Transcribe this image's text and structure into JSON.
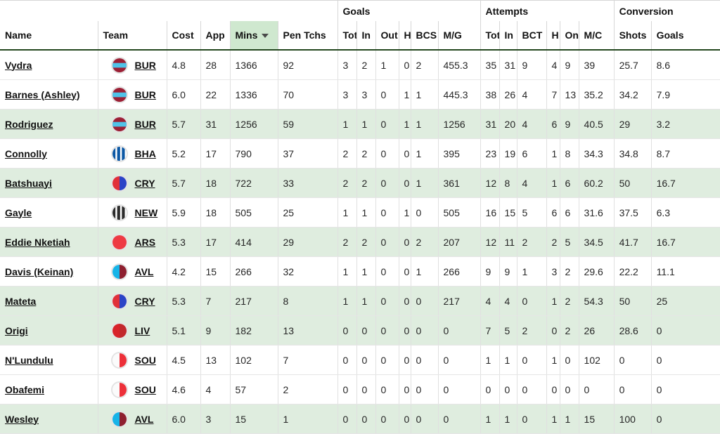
{
  "table": {
    "group_headers": [
      {
        "label": "",
        "span": 6
      },
      {
        "label": "Goals",
        "span": 6
      },
      {
        "label": "Attempts",
        "span": 6
      },
      {
        "label": "Conversion",
        "span": 2
      }
    ],
    "columns": [
      {
        "key": "name",
        "label": "Name",
        "sorted": false
      },
      {
        "key": "team",
        "label": "Team",
        "sorted": false
      },
      {
        "key": "cost",
        "label": "Cost",
        "sorted": false
      },
      {
        "key": "app",
        "label": "App",
        "sorted": false
      },
      {
        "key": "mins",
        "label": "Mins",
        "sorted": true,
        "sort_dir": "desc",
        "sort_icon": "caret-down-icon"
      },
      {
        "key": "pen",
        "label": "Pen Tchs",
        "sorted": false
      },
      {
        "key": "gtot",
        "label": "Tot",
        "sorted": false
      },
      {
        "key": "gin",
        "label": "In",
        "sorted": false
      },
      {
        "key": "gout",
        "label": "Out",
        "sorted": false
      },
      {
        "key": "gh",
        "label": "H",
        "sorted": false
      },
      {
        "key": "gbcs",
        "label": "BCS",
        "sorted": false
      },
      {
        "key": "gmg",
        "label": "M/G",
        "sorted": false
      },
      {
        "key": "atot",
        "label": "Tot",
        "sorted": false
      },
      {
        "key": "ain",
        "label": "In",
        "sorted": false
      },
      {
        "key": "abct",
        "label": "BCT",
        "sorted": false
      },
      {
        "key": "ah",
        "label": "H",
        "sorted": false
      },
      {
        "key": "aon",
        "label": "On",
        "sorted": false
      },
      {
        "key": "amc",
        "label": "M/C",
        "sorted": false
      },
      {
        "key": "cshots",
        "label": "Shots",
        "sorted": false
      },
      {
        "key": "cgoals",
        "label": "Goals",
        "sorted": false
      }
    ],
    "rows": [
      {
        "name": "Vydra",
        "team": "BUR",
        "badge": "bur-badge",
        "shaded": false,
        "cost": "4.8",
        "app": "28",
        "mins": "1366",
        "pen": "92",
        "gtot": "3",
        "gin": "2",
        "gout": "1",
        "gh": "0",
        "gbcs": "2",
        "gmg": "455.3",
        "atot": "35",
        "ain": "31",
        "abct": "9",
        "ah": "4",
        "aon": "9",
        "amc": "39",
        "cshots": "25.7",
        "cgoals": "8.6"
      },
      {
        "name": "Barnes (Ashley)",
        "team": "BUR",
        "badge": "bur-badge",
        "shaded": false,
        "cost": "6.0",
        "app": "22",
        "mins": "1336",
        "pen": "70",
        "gtot": "3",
        "gin": "3",
        "gout": "0",
        "gh": "1",
        "gbcs": "1",
        "gmg": "445.3",
        "atot": "38",
        "ain": "26",
        "abct": "4",
        "ah": "7",
        "aon": "13",
        "amc": "35.2",
        "cshots": "34.2",
        "cgoals": "7.9"
      },
      {
        "name": "Rodriguez",
        "team": "BUR",
        "badge": "bur-badge",
        "shaded": true,
        "cost": "5.7",
        "app": "31",
        "mins": "1256",
        "pen": "59",
        "gtot": "1",
        "gin": "1",
        "gout": "0",
        "gh": "1",
        "gbcs": "1",
        "gmg": "1256",
        "atot": "31",
        "ain": "20",
        "abct": "4",
        "ah": "6",
        "aon": "9",
        "amc": "40.5",
        "cshots": "29",
        "cgoals": "3.2"
      },
      {
        "name": "Connolly",
        "team": "BHA",
        "badge": "bha-badge",
        "shaded": false,
        "cost": "5.2",
        "app": "17",
        "mins": "790",
        "pen": "37",
        "gtot": "2",
        "gin": "2",
        "gout": "0",
        "gh": "0",
        "gbcs": "1",
        "gmg": "395",
        "atot": "23",
        "ain": "19",
        "abct": "6",
        "ah": "1",
        "aon": "8",
        "amc": "34.3",
        "cshots": "34.8",
        "cgoals": "8.7"
      },
      {
        "name": "Batshuayi",
        "team": "CRY",
        "badge": "cry-badge",
        "shaded": true,
        "cost": "5.7",
        "app": "18",
        "mins": "722",
        "pen": "33",
        "gtot": "2",
        "gin": "2",
        "gout": "0",
        "gh": "0",
        "gbcs": "1",
        "gmg": "361",
        "atot": "12",
        "ain": "8",
        "abct": "4",
        "ah": "1",
        "aon": "6",
        "amc": "60.2",
        "cshots": "50",
        "cgoals": "16.7"
      },
      {
        "name": "Gayle",
        "team": "NEW",
        "badge": "new-badge",
        "shaded": false,
        "cost": "5.9",
        "app": "18",
        "mins": "505",
        "pen": "25",
        "gtot": "1",
        "gin": "1",
        "gout": "0",
        "gh": "1",
        "gbcs": "0",
        "gmg": "505",
        "atot": "16",
        "ain": "15",
        "abct": "5",
        "ah": "6",
        "aon": "6",
        "amc": "31.6",
        "cshots": "37.5",
        "cgoals": "6.3"
      },
      {
        "name": "Eddie Nketiah",
        "team": "ARS",
        "badge": "ars-badge",
        "shaded": true,
        "cost": "5.3",
        "app": "17",
        "mins": "414",
        "pen": "29",
        "gtot": "2",
        "gin": "2",
        "gout": "0",
        "gh": "0",
        "gbcs": "2",
        "gmg": "207",
        "atot": "12",
        "ain": "11",
        "abct": "2",
        "ah": "2",
        "aon": "5",
        "amc": "34.5",
        "cshots": "41.7",
        "cgoals": "16.7"
      },
      {
        "name": "Davis (Keinan)",
        "team": "AVL",
        "badge": "avl-badge",
        "shaded": false,
        "cost": "4.2",
        "app": "15",
        "mins": "266",
        "pen": "32",
        "gtot": "1",
        "gin": "1",
        "gout": "0",
        "gh": "0",
        "gbcs": "1",
        "gmg": "266",
        "atot": "9",
        "ain": "9",
        "abct": "1",
        "ah": "3",
        "aon": "2",
        "amc": "29.6",
        "cshots": "22.2",
        "cgoals": "11.1"
      },
      {
        "name": "Mateta",
        "team": "CRY",
        "badge": "cry-badge",
        "shaded": true,
        "cost": "5.3",
        "app": "7",
        "mins": "217",
        "pen": "8",
        "gtot": "1",
        "gin": "1",
        "gout": "0",
        "gh": "0",
        "gbcs": "0",
        "gmg": "217",
        "atot": "4",
        "ain": "4",
        "abct": "0",
        "ah": "1",
        "aon": "2",
        "amc": "54.3",
        "cshots": "50",
        "cgoals": "25"
      },
      {
        "name": "Origi",
        "team": "LIV",
        "badge": "liv-badge",
        "shaded": true,
        "cost": "5.1",
        "app": "9",
        "mins": "182",
        "pen": "13",
        "gtot": "0",
        "gin": "0",
        "gout": "0",
        "gh": "0",
        "gbcs": "0",
        "gmg": "0",
        "atot": "7",
        "ain": "5",
        "abct": "2",
        "ah": "0",
        "aon": "2",
        "amc": "26",
        "cshots": "28.6",
        "cgoals": "0"
      },
      {
        "name": "N'Lundulu",
        "team": "SOU",
        "badge": "sou-badge",
        "shaded": false,
        "cost": "4.5",
        "app": "13",
        "mins": "102",
        "pen": "7",
        "gtot": "0",
        "gin": "0",
        "gout": "0",
        "gh": "0",
        "gbcs": "0",
        "gmg": "0",
        "atot": "1",
        "ain": "1",
        "abct": "0",
        "ah": "1",
        "aon": "0",
        "amc": "102",
        "cshots": "0",
        "cgoals": "0"
      },
      {
        "name": "Obafemi",
        "team": "SOU",
        "badge": "sou-badge",
        "shaded": false,
        "cost": "4.6",
        "app": "4",
        "mins": "57",
        "pen": "2",
        "gtot": "0",
        "gin": "0",
        "gout": "0",
        "gh": "0",
        "gbcs": "0",
        "gmg": "0",
        "atot": "0",
        "ain": "0",
        "abct": "0",
        "ah": "0",
        "aon": "0",
        "amc": "0",
        "cshots": "0",
        "cgoals": "0"
      },
      {
        "name": "Wesley",
        "team": "AVL",
        "badge": "avl-badge",
        "shaded": true,
        "cost": "6.0",
        "app": "3",
        "mins": "15",
        "pen": "1",
        "gtot": "0",
        "gin": "0",
        "gout": "0",
        "gh": "0",
        "gbcs": "0",
        "gmg": "0",
        "atot": "1",
        "ain": "1",
        "abct": "0",
        "ah": "1",
        "aon": "1",
        "amc": "15",
        "cshots": "100",
        "cgoals": "0"
      }
    ]
  },
  "colors": {
    "row_shaded": "#dfeddf",
    "sorted_header": "#cfe8cf",
    "header_underline": "#24471f",
    "grid_line": "#e0e0e0",
    "text": "#262626"
  }
}
